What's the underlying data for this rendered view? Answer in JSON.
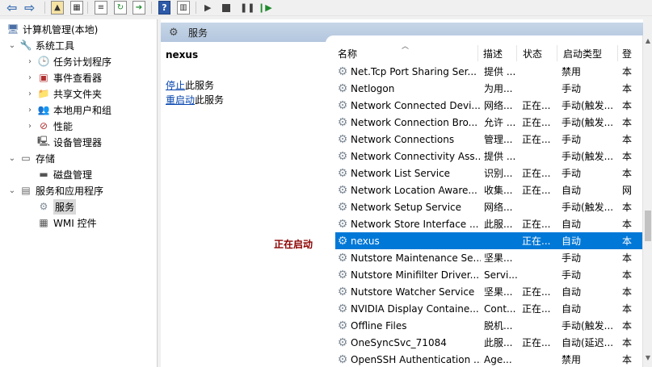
{
  "toolbar": {
    "back_glyph": "⇦",
    "forward_glyph": "⇨",
    "help_glyph": "?",
    "play_glyph": "▶",
    "pause_glyph": "❚❚",
    "resume_glyph": "❙▶"
  },
  "tree": {
    "root": "计算机管理(本地)",
    "items": [
      {
        "label": "系统工具",
        "icon": "tools-icon"
      },
      {
        "label": "任务计划程序",
        "icon": "clock-icon"
      },
      {
        "label": "事件查看器",
        "icon": "event-viewer-icon"
      },
      {
        "label": "共享文件夹",
        "icon": "shared-folder-icon"
      },
      {
        "label": "本地用户和组",
        "icon": "users-icon"
      },
      {
        "label": "性能",
        "icon": "performance-icon"
      },
      {
        "label": "设备管理器",
        "icon": "device-manager-icon"
      },
      {
        "label": "存储",
        "icon": "storage-icon"
      },
      {
        "label": "磁盘管理",
        "icon": "disk-icon"
      },
      {
        "label": "服务和应用程序",
        "icon": "apps-icon"
      },
      {
        "label": "服务",
        "icon": "services-icon"
      },
      {
        "label": "WMI 控件",
        "icon": "wmi-icon"
      }
    ]
  },
  "panel": {
    "title": "服务",
    "selected_service": "nexus",
    "stop_link": "停止",
    "stop_suffix": "此服务",
    "restart_link": "重启动",
    "restart_suffix": "此服务",
    "status_note": "正在启动"
  },
  "columns": {
    "name": "名称",
    "desc": "描述",
    "status": "状态",
    "start_type": "启动类型",
    "logon": "登"
  },
  "rows": [
    {
      "name": "Net.Tcp Port Sharing Ser...",
      "desc": "提供 ...",
      "status": "",
      "start": "禁用",
      "logon": "本"
    },
    {
      "name": "Netlogon",
      "desc": "为用...",
      "status": "",
      "start": "手动",
      "logon": "本"
    },
    {
      "name": "Network Connected Devi...",
      "desc": "网络...",
      "status": "正在...",
      "start": "手动(触发...",
      "logon": "本"
    },
    {
      "name": "Network Connection Bro...",
      "desc": "允许 ...",
      "status": "正在...",
      "start": "手动(触发...",
      "logon": "本"
    },
    {
      "name": "Network Connections",
      "desc": "管理...",
      "status": "正在...",
      "start": "手动",
      "logon": "本"
    },
    {
      "name": "Network Connectivity Ass...",
      "desc": "提供 ...",
      "status": "",
      "start": "手动(触发...",
      "logon": "本"
    },
    {
      "name": "Network List Service",
      "desc": "识别...",
      "status": "正在...",
      "start": "手动",
      "logon": "本"
    },
    {
      "name": "Network Location Aware...",
      "desc": "收集...",
      "status": "正在...",
      "start": "自动",
      "logon": "网"
    },
    {
      "name": "Network Setup Service",
      "desc": "网络...",
      "status": "",
      "start": "手动(触发...",
      "logon": "本"
    },
    {
      "name": "Network Store Interface ...",
      "desc": "此服...",
      "status": "正在...",
      "start": "自动",
      "logon": "本"
    },
    {
      "name": "nexus",
      "desc": "",
      "status": "正在...",
      "start": "自动",
      "logon": "本",
      "selected": true
    },
    {
      "name": "Nutstore Maintenance Se...",
      "desc": "坚果...",
      "status": "",
      "start": "手动",
      "logon": "本"
    },
    {
      "name": "Nutstore Minifilter Driver...",
      "desc": "Servi...",
      "status": "",
      "start": "手动",
      "logon": "本"
    },
    {
      "name": "Nutstore Watcher Service",
      "desc": "坚果...",
      "status": "正在...",
      "start": "自动",
      "logon": "本"
    },
    {
      "name": "NVIDIA Display Containe...",
      "desc": "Cont...",
      "status": "正在...",
      "start": "自动",
      "logon": "本"
    },
    {
      "name": "Offline Files",
      "desc": "脱机...",
      "status": "",
      "start": "手动(触发...",
      "logon": "本"
    },
    {
      "name": "OneSyncSvc_71084",
      "desc": "此服...",
      "status": "正在...",
      "start": "自动(延迟...",
      "logon": "本"
    },
    {
      "name": "OpenSSH Authentication ...",
      "desc": "Age...",
      "status": "",
      "start": "禁用",
      "logon": "本"
    }
  ],
  "colors": {
    "selection": "#0078d7",
    "header_band": "#b3c6de",
    "link": "#0645ad",
    "status_note": "#8b0000"
  }
}
